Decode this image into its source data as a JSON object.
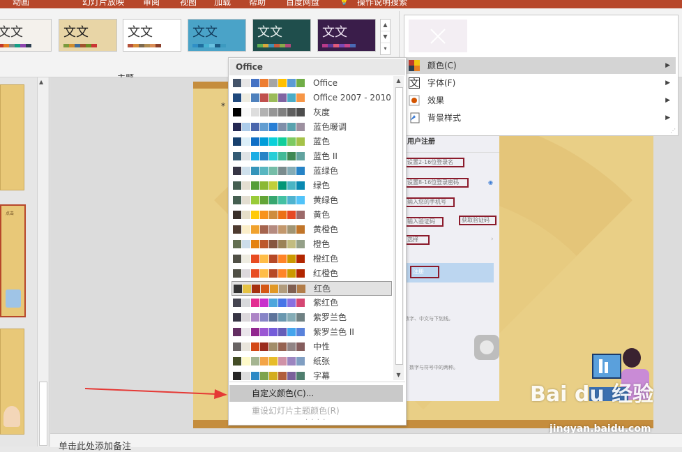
{
  "ribbon": {
    "tabs": [
      "动画",
      "幻灯片放映",
      "审阅",
      "视图",
      "加载",
      "帮助",
      "百度网盘",
      "操作说明搜索"
    ],
    "group_label": "主题",
    "theme_thumbs": [
      {
        "text": "文文",
        "bg": "#f4f1ec",
        "fg": "#333333",
        "bars": [
          "#c0392b",
          "#e67e22",
          "#7f8c8d",
          "#16a085",
          "#8e44ad",
          "#2c3e50"
        ]
      },
      {
        "text": "文文",
        "bg": "#e8d5a6",
        "fg": "#1a1a1a",
        "bars": [
          "#7b9a3c",
          "#d08b2c",
          "#3e6a9a",
          "#a0522d",
          "#6b8e23",
          "#cc3333"
        ]
      },
      {
        "text": "文文",
        "bg": "#ffffff",
        "fg": "#333333",
        "bars": [
          "#b5523b",
          "#d88c3a",
          "#7d6a4f",
          "#b28c52",
          "#d98d56",
          "#8a3f2a"
        ]
      },
      {
        "text": "文文",
        "bg": "#4aa3c8",
        "fg": "#123a5a",
        "bars": [
          "#2f8fc6",
          "#1f6f9f",
          "#45b0d0",
          "#69c1e0",
          "#1b5b84",
          "#3c9ac0"
        ]
      },
      {
        "text": "文文",
        "bg": "#1f4e4c",
        "fg": "#e8f0ee",
        "bars": [
          "#5fae54",
          "#d8a83a",
          "#3f8fb4",
          "#c85b3c",
          "#8aa84a",
          "#b04a7a"
        ]
      },
      {
        "text": "文文",
        "bg": "#3a1d4a",
        "fg": "#f1e6f5",
        "bars": [
          "#b83a8a",
          "#5a3a9a",
          "#e05a7a",
          "#7a4ab4",
          "#c8458a",
          "#4a6ab4"
        ]
      }
    ]
  },
  "colors_menu": {
    "header": "Office",
    "custom": "自定义颜色(C)...",
    "reset": "重设幻灯片主题颜色(R)",
    "items": [
      {
        "label": "Office",
        "swatches": [
          "#44546a",
          "#e7e6e6",
          "#4472c4",
          "#ed7d31",
          "#a5a5a5",
          "#ffc000",
          "#5b9bd5",
          "#70ad47"
        ]
      },
      {
        "label": "Office 2007 - 2010",
        "swatches": [
          "#1f497d",
          "#eeece1",
          "#4f81bd",
          "#c0504d",
          "#9bbb59",
          "#8064a2",
          "#4bacc6",
          "#f79646"
        ]
      },
      {
        "label": "灰度",
        "swatches": [
          "#000000",
          "#f8f8f8",
          "#dddddd",
          "#b2b2b2",
          "#969696",
          "#808080",
          "#5f5f5f",
          "#4d4d4d"
        ]
      },
      {
        "label": "蓝色暖调",
        "swatches": [
          "#242852",
          "#acccea",
          "#4a66ac",
          "#629dd1",
          "#297fd5",
          "#7f8fa9",
          "#5aa2ae",
          "#9d90a0"
        ]
      },
      {
        "label": "蓝色",
        "swatches": [
          "#17406d",
          "#dbeff9",
          "#0f6fc6",
          "#009dd9",
          "#0bd0d9",
          "#10cf9b",
          "#7cca62",
          "#a5c249"
        ]
      },
      {
        "label": "蓝色 II",
        "swatches": [
          "#335b74",
          "#dfe3e5",
          "#1cade4",
          "#2683c6",
          "#27ced7",
          "#42ba97",
          "#3e8853",
          "#62a39f"
        ]
      },
      {
        "label": "蓝绿色",
        "swatches": [
          "#373545",
          "#cee0ec",
          "#3494ba",
          "#58b6c0",
          "#75bda7",
          "#7a8c8e",
          "#84acb6",
          "#2683c6"
        ]
      },
      {
        "label": "绿色",
        "swatches": [
          "#455f51",
          "#e3ded1",
          "#549e39",
          "#8ab833",
          "#c0cf3a",
          "#029676",
          "#4ab5c4",
          "#0989b1"
        ]
      },
      {
        "label": "黄绿色",
        "swatches": [
          "#455f51",
          "#e3ded1",
          "#99cb38",
          "#63a537",
          "#37a76f",
          "#44c1a3",
          "#4eb3cf",
          "#51c3f9"
        ]
      },
      {
        "label": "黄色",
        "swatches": [
          "#39302a",
          "#e5dec9",
          "#ffca08",
          "#f8931d",
          "#ce8d3e",
          "#ec7016",
          "#e64823",
          "#9c6a6a"
        ]
      },
      {
        "label": "黄橙色",
        "swatches": [
          "#4e3b30",
          "#fbeec9",
          "#f0a22e",
          "#a5644e",
          "#b58b80",
          "#c3986d",
          "#a19574",
          "#c17529"
        ]
      },
      {
        "label": "橙色",
        "swatches": [
          "#637052",
          "#ccddea",
          "#e48312",
          "#bd582c",
          "#865640",
          "#9b8357",
          "#c2bc80",
          "#94a088"
        ]
      },
      {
        "label": "橙红色",
        "swatches": [
          "#505046",
          "#eeece1",
          "#e84c22",
          "#ffbd47",
          "#b64926",
          "#ff8427",
          "#cc9900",
          "#b22600"
        ]
      },
      {
        "label": "红橙色",
        "swatches": [
          "#505046",
          "#dcd8dc",
          "#e84c22",
          "#ffbd47",
          "#b64926",
          "#ff8427",
          "#cc9900",
          "#b22600"
        ]
      },
      {
        "label": "红色",
        "swatches": [
          "#323232",
          "#e5c243",
          "#a5300f",
          "#d55816",
          "#e19825",
          "#b19c7d",
          "#7f5f52",
          "#b27d49"
        ]
      },
      {
        "label": "紫红色",
        "swatches": [
          "#454551",
          "#d8d9dc",
          "#e32d91",
          "#c830cc",
          "#4ea6dc",
          "#4775e7",
          "#8971e1",
          "#d54773"
        ]
      },
      {
        "label": "紫罗兰色",
        "swatches": [
          "#373545",
          "#dcd8dc",
          "#ad84c6",
          "#8784c7",
          "#5d739a",
          "#6997af",
          "#84acb6",
          "#6f8183"
        ]
      },
      {
        "label": "紫罗兰色 II",
        "swatches": [
          "#632e62",
          "#eae5eb",
          "#92278f",
          "#9b57d3",
          "#755dd9",
          "#665eb8",
          "#45a5ed",
          "#5982db"
        ]
      },
      {
        "label": "中性",
        "swatches": [
          "#696464",
          "#e9e5dc",
          "#d34817",
          "#9b2d1f",
          "#a28e6a",
          "#956251",
          "#918485",
          "#855d5d"
        ]
      },
      {
        "label": "纸张",
        "swatches": [
          "#444d26",
          "#fefac9",
          "#a5b592",
          "#f3a447",
          "#e7bc29",
          "#d092a7",
          "#9c85c0",
          "#809ec2"
        ]
      },
      {
        "label": "字幕",
        "swatches": [
          "#262626",
          "#dddddd",
          "#2d89c5",
          "#7da44c",
          "#d3ad1f",
          "#b15e3c",
          "#7a619a",
          "#4f7e6e"
        ]
      }
    ]
  },
  "variants_menu": {
    "items": [
      {
        "label": "颜色(C)",
        "icon": "color-palette-icon"
      },
      {
        "label": "字体(F)",
        "icon": "font-icon"
      },
      {
        "label": "效果",
        "icon": "effects-icon"
      },
      {
        "label": "背景样式",
        "icon": "background-style-icon"
      }
    ]
  },
  "phone": {
    "title": "用户注册",
    "fields": [
      "设置2-16位登录名",
      "设置8-16位登录密码",
      "输入您的手机号",
      "输入验证码",
      "获取验证码",
      "选择"
    ],
    "button": "注册",
    "hint1": "数字、中文与下划线。",
    "hint2": "，数字与符号中的两种。"
  },
  "left_panel": {
    "slide_text": "点击"
  },
  "notes": {
    "placeholder": "单击此处添加备注"
  },
  "watermark": {
    "brand": "Bai du 经验",
    "url": "jingyan.baidu.com"
  },
  "colors": {
    "accent": "#b7472a",
    "arrow": "#e53935",
    "field_border": "#8b1a2b"
  }
}
